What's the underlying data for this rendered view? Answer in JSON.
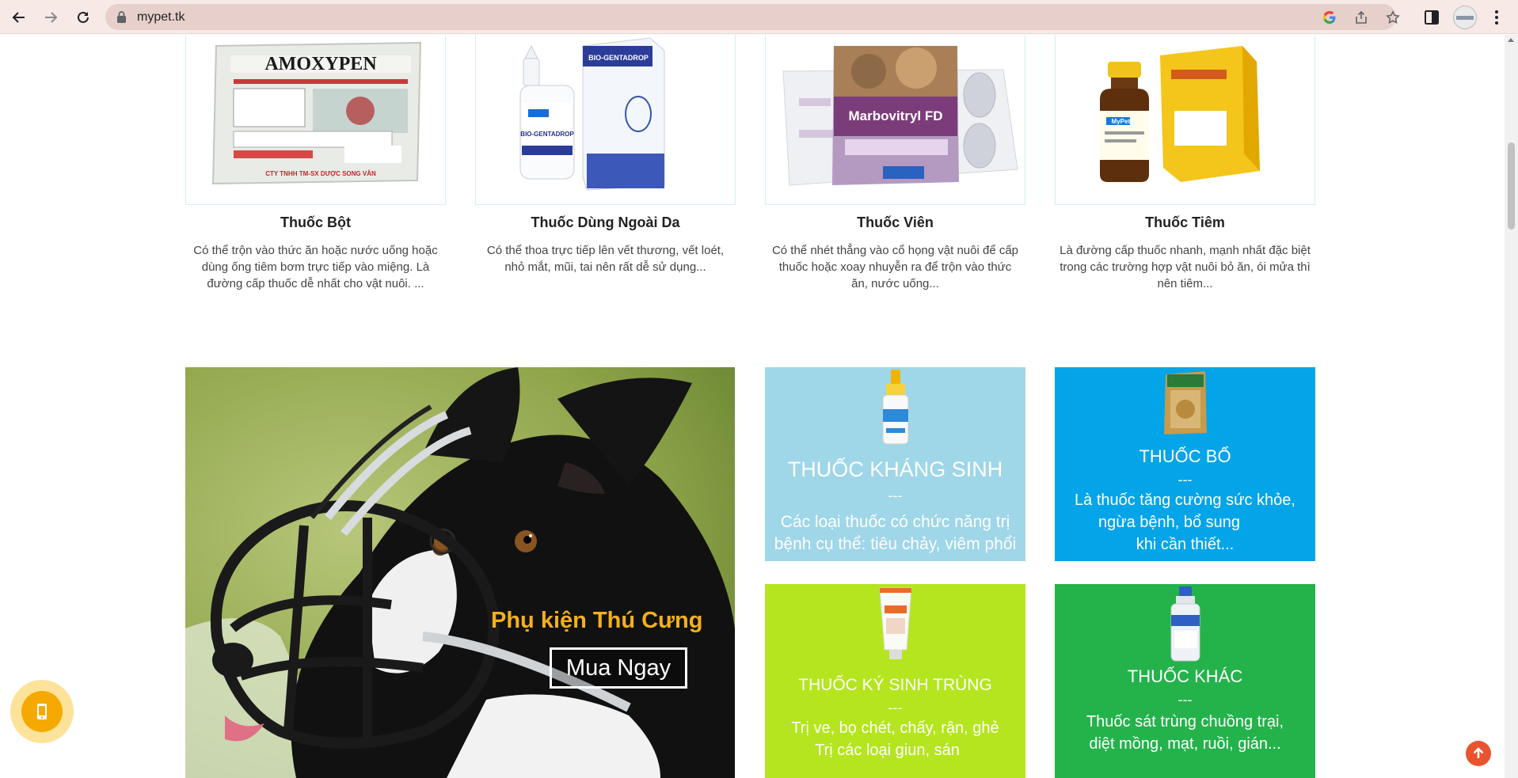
{
  "browser": {
    "url": "mypet.tk",
    "icons": [
      "back-arrow-icon",
      "forward-arrow-icon",
      "reload-icon",
      "lock-icon",
      "google-icon",
      "share-icon",
      "star-icon",
      "side-panel-icon",
      "profile-avatar",
      "more-vert-icon"
    ]
  },
  "products": [
    {
      "title": "Thuốc Bột",
      "desc": "Có thể trộn vào thức ăn hoặc nước uống hoặc dùng ống tiêm bơm trực tiếp vào miệng. Là đường cấp thuốc dễ nhất cho vật nuôi. ...",
      "label_brand": "AMOXYPEN",
      "label_company": "CTY TNHH TM-SX DƯỢC SONG VÂN"
    },
    {
      "title": "Thuốc Dùng Ngoài Da",
      "desc": "Có thể thoa trực tiếp lên vết thương, vết loét, nhỏ mắt, mũi, tai nên rất dễ sử dụng...",
      "label_brand": "BIO-GENTADROP"
    },
    {
      "title": "Thuốc Viên",
      "desc": "Có thể nhét thẳng vào cổ họng vật nuôi để cấp thuốc hoặc xoay nhuyễn ra để trộn vào thức ăn, nước uống...",
      "label_brand": "Marbovitryl FD"
    },
    {
      "title": "Thuốc Tiêm",
      "desc": "Là đường cấp thuốc nhanh, mạnh nhất đặc biệt trong các trường hợp vật nuôi bỏ ăn, ói mửa thì nên tiêm...",
      "label_brand": "MyPet.tk"
    }
  ],
  "hero": {
    "title": "Phụ kiện Thú Cưng",
    "button": "Mua Ngay"
  },
  "tiles": [
    {
      "title": "THUỐC KHÁNG SINH",
      "dash": "---",
      "desc_lines": [
        "Các loại thuốc có chức năng trị",
        "bệnh cụ thể: tiêu chảy, viêm phổi"
      ],
      "color": "#9fd6e8"
    },
    {
      "title": "THUỐC BỔ",
      "dash": "---",
      "desc_lines": [
        "Là thuốc tăng cường sức khỏe,",
        "ngừa bệnh, bổ sung",
        "khi cần thiết..."
      ],
      "color": "#04a4e8"
    },
    {
      "title": "THUỐC KÝ SINH TRÙNG",
      "dash": "---",
      "desc_lines": [
        "Trị ve, bọ chét, chấy, rận, ghẻ",
        "Trị các loại giun, sán"
      ],
      "color": "#b4e51f"
    },
    {
      "title": "THUỐC KHÁC",
      "dash": "---",
      "desc_lines": [
        "Thuốc sát trùng chuồng trại,",
        "diệt mồng, mạt, ruồi, gián..."
      ],
      "color": "#24b24b"
    }
  ]
}
